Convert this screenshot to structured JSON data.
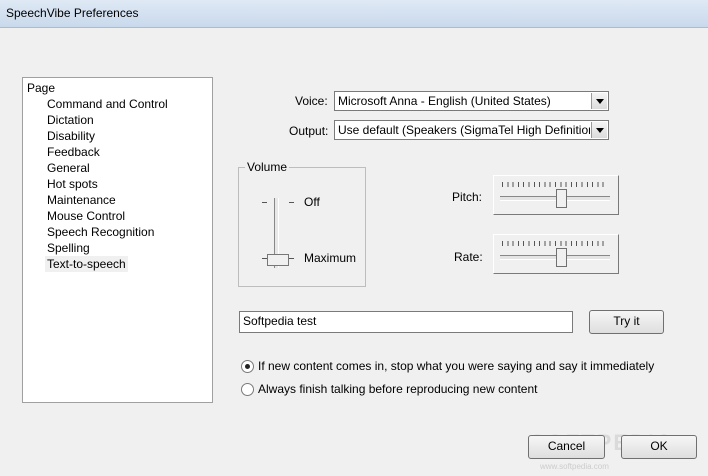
{
  "window": {
    "title": "SpeechVibe Preferences"
  },
  "tree": {
    "root": "Page",
    "items": [
      "Command and Control",
      "Dictation",
      "Disability",
      "Feedback",
      "General",
      "Hot spots",
      "Maintenance",
      "Mouse Control",
      "Speech Recognition",
      "Spelling",
      "Text-to-speech"
    ],
    "selected": "Text-to-speech"
  },
  "voice": {
    "label": "Voice:",
    "value": "Microsoft Anna - English (United States)"
  },
  "output": {
    "label": "Output:",
    "value": "Use default (Speakers (SigmaTel High Definition Audi"
  },
  "volume": {
    "legend": "Volume",
    "off_label": "Off",
    "max_label": "Maximum",
    "level": "Maximum"
  },
  "pitch": {
    "label": "Pitch:",
    "level": 0.5
  },
  "rate": {
    "label": "Rate:",
    "level": 0.5
  },
  "test": {
    "value": "Softpedia test",
    "button": "Try it"
  },
  "options": {
    "interrupt": {
      "label": "If new content comes in, stop what you were saying and say it immediately",
      "checked": true
    },
    "finish": {
      "label": "Always finish talking before reproducing new content",
      "checked": false
    }
  },
  "buttons": {
    "cancel": "Cancel",
    "ok": "OK"
  },
  "watermark": {
    "brand": "SOFTPEDIA",
    "url": "www.softpedia.com"
  }
}
